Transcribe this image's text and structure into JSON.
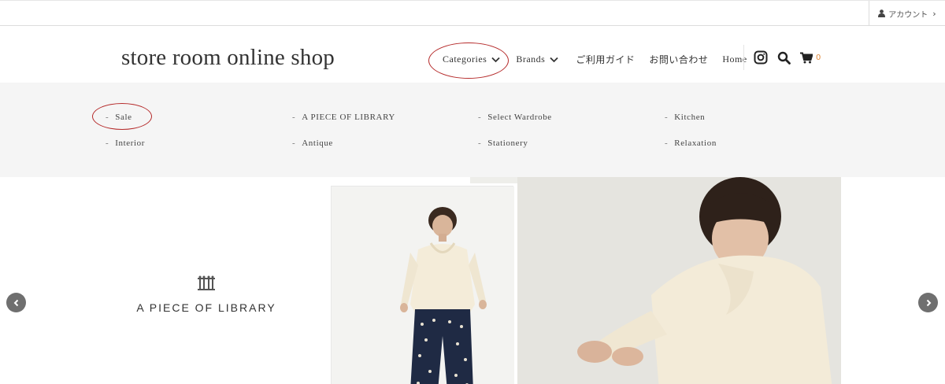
{
  "topbar": {
    "account_label": "アカウント"
  },
  "header": {
    "logo": "store room online shop",
    "nav": {
      "categories": "Categories",
      "brands": "Brands",
      "guide": "ご利用ガイド",
      "contact": "お問い合わせ",
      "home": "Home"
    },
    "cart_count": "0"
  },
  "categories_menu": {
    "items": [
      {
        "label": "Sale"
      },
      {
        "label": "A PIECE OF LIBRARY"
      },
      {
        "label": "Select Wardrobe"
      },
      {
        "label": "Kitchen"
      },
      {
        "label": "Interior"
      },
      {
        "label": "Antique"
      },
      {
        "label": "Stationery"
      },
      {
        "label": "Relaxation"
      }
    ],
    "dash": "-"
  },
  "hero": {
    "brand_name": "A PIECE OF LIBRARY"
  },
  "colors": {
    "annotation": "#b52a2a",
    "cart_count": "#e08a3c",
    "menu_bg": "#f5f5f5"
  },
  "icons": [
    "user-icon",
    "chevron-right-icon",
    "chevron-down-icon",
    "instagram-icon",
    "search-icon",
    "cart-icon",
    "brand-emblem-icon",
    "prev-arrow-icon",
    "next-arrow-icon"
  ]
}
